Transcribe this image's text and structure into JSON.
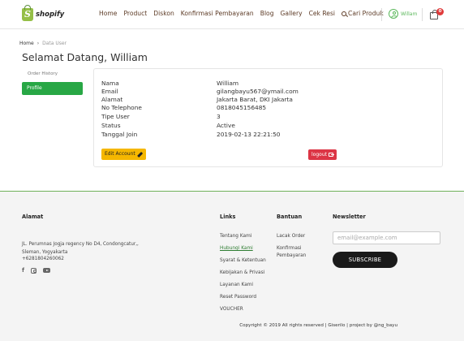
{
  "header": {
    "logo_text": "shopify",
    "nav": [
      {
        "label": "Home"
      },
      {
        "label": "Product"
      },
      {
        "label": "Diskon"
      },
      {
        "label": "Konfirmasi Pembayaran"
      },
      {
        "label": "Blog"
      },
      {
        "label": "Gallery"
      },
      {
        "label": "Cek Resi"
      },
      {
        "label": "Cari Produk"
      }
    ],
    "user_name": "Willam",
    "cart_count": "0"
  },
  "breadcrumb": {
    "home": "Home",
    "separator": "›",
    "current": "Data User"
  },
  "title": "Selamat Datang, William",
  "sidebar": {
    "history": "Order History",
    "profile": "Profile"
  },
  "profile": {
    "rows": [
      {
        "label": "Nama",
        "value": "William"
      },
      {
        "label": "Email",
        "value": "gilangbayu567@ymail.com"
      },
      {
        "label": "Alamat",
        "value": "Jakarta Barat, DKI Jakarta"
      },
      {
        "label": "No Telephone",
        "value": "0818045156485"
      },
      {
        "label": "Tipe User",
        "value": "3"
      },
      {
        "label": "Status",
        "value": "Active"
      },
      {
        "label": "Tanggal Join",
        "value": "2019-02-13 22:21:50"
      }
    ],
    "edit_label": "Edit Account",
    "logout_label": "logout"
  },
  "footer": {
    "alamat": {
      "heading": "Alamat",
      "lines": [
        "JL. Perumnas Jogja regency No D4, Condongcatur,,",
        "Sleman, Yogyakarta",
        "+6281804260062"
      ]
    },
    "links": {
      "heading": "Links",
      "items": [
        "Tentang Kami",
        "Hubungi Kami",
        "Syarat & Ketentuan",
        "Kebijakan & Privasi",
        "Layanan Kami",
        "Reset Password",
        "VOUCHER"
      ]
    },
    "bantuan": {
      "heading": "Bantuan",
      "items": [
        "Lacak Order",
        "Konfirmasi",
        "Pembayaran"
      ]
    },
    "newsletter": {
      "heading": "Newsletter",
      "placeholder": "email@example.com",
      "button": "SUBSCRIBE"
    },
    "copyright": "Copyright © 2019 All rights reserved | Giserilo | project by @ng_bayu"
  },
  "colors": {
    "nav_text": "#5c3a25",
    "green": "#28a745",
    "edit_button": "#f5b700",
    "logout_button": "#dc3545",
    "cart_badge": "#e03b3b"
  }
}
